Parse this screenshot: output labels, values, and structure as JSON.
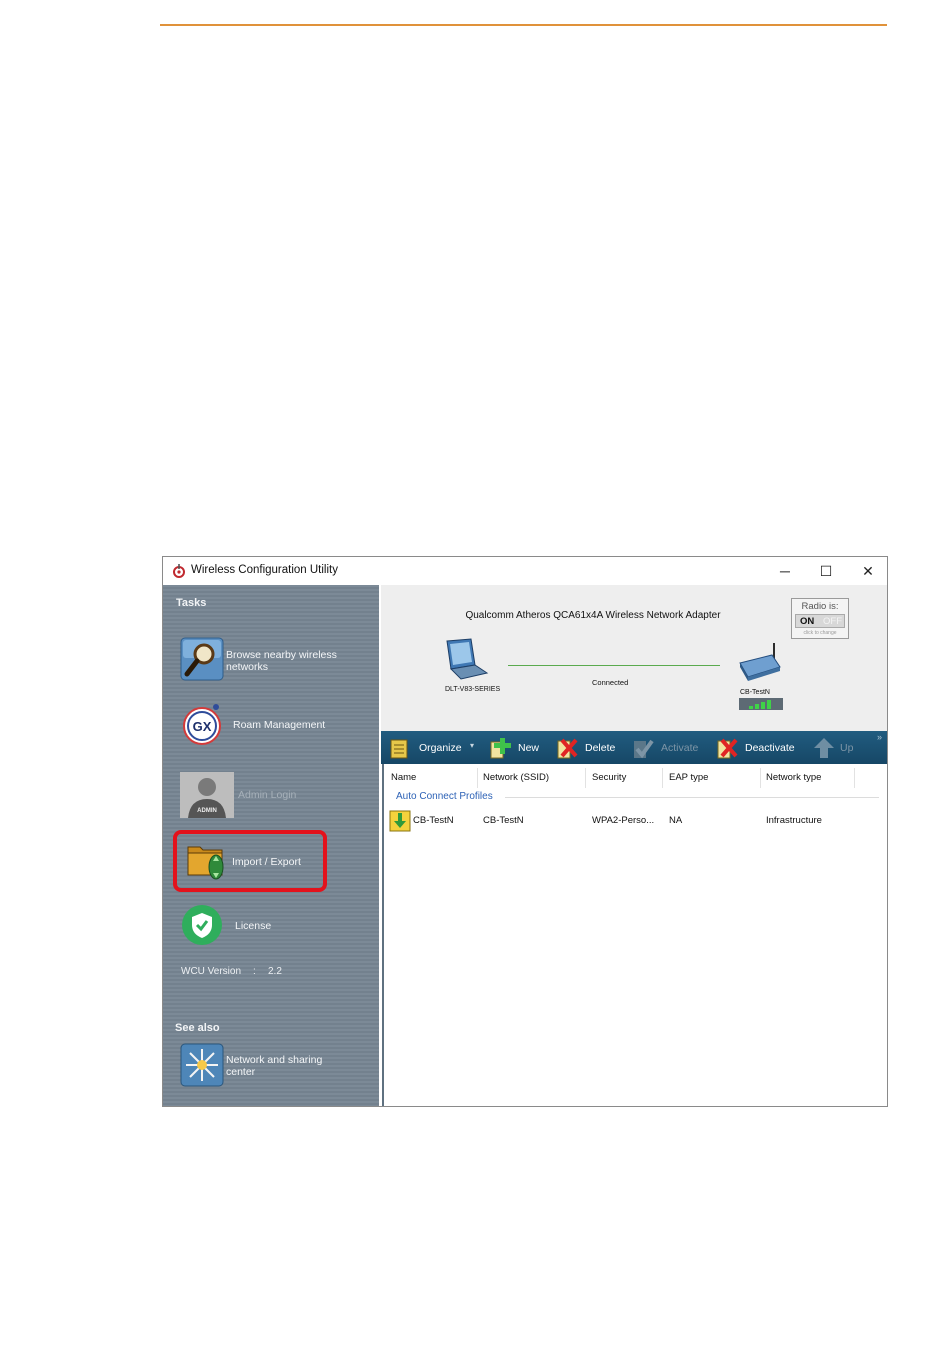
{
  "window": {
    "title": "Wireless Configuration Utility",
    "controls": {
      "minimize": "─",
      "maximize": "☐",
      "close": "✕"
    }
  },
  "taskpane": {
    "tasks_header": "Tasks",
    "tasks": [
      {
        "label_line1": "Browse nearby wireless",
        "label_line2": "networks",
        "icon": "magnifier-icon"
      },
      {
        "label_line1": "Roam Management",
        "icon": "gx-roam-icon"
      },
      {
        "label_line1": "Admin Login",
        "icon": "admin-avatar-icon",
        "disabled": true
      },
      {
        "label_line1": "Import / Export",
        "icon": "folder-import-export-icon",
        "highlighted": true
      },
      {
        "label_line1": "License",
        "icon": "shield-check-icon"
      }
    ],
    "version_label": "WCU Version",
    "version_sep": ":",
    "version_value": "2.2",
    "see_also_header": "See also",
    "see_also": [
      {
        "label_line1": "Network and sharing",
        "label_line2": "center",
        "icon": "network-sharing-icon"
      }
    ]
  },
  "status": {
    "adapter_name": "Qualcomm Atheros QCA61x4A Wireless Network Adapter",
    "radio_label": "Radio is:",
    "radio_on": "ON",
    "radio_off": "OFF",
    "radio_hint": "click to change",
    "laptop_label": "DLT-V83-SERIES",
    "connection_state": "Connected",
    "router_label": "CB-TestN",
    "signal_bars": 4
  },
  "toolbar": {
    "organize": "Organize",
    "organize_arrow": "▾",
    "new": "New",
    "delete": "Delete",
    "activate": "Activate",
    "deactivate": "Deactivate",
    "up": "Up",
    "more": "»"
  },
  "profiles": {
    "columns": [
      "Name",
      "Network (SSID)",
      "Security",
      "EAP type",
      "Network type"
    ],
    "group_title": "Auto Connect Profiles",
    "rows": [
      {
        "name": "CB-TestN",
        "ssid": "CB-TestN",
        "security": "WPA2-Perso...",
        "eap": "NA",
        "type": "Infrastructure"
      }
    ]
  },
  "colors": {
    "accent_rule": "#e0923a",
    "taskpane": "#7c8a97",
    "toolbar": "#1a4f72",
    "highlight": "#e3121c",
    "group_text": "#2d62b6",
    "link_line": "#5aaa4e"
  }
}
